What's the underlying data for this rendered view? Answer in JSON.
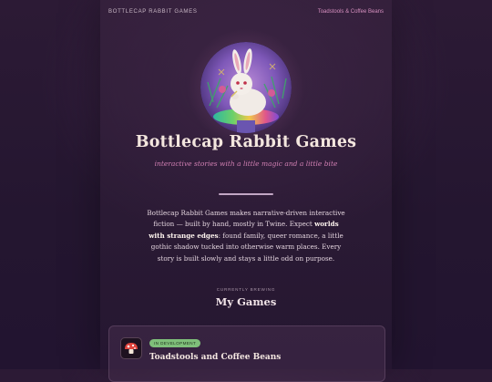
{
  "header": {
    "brand": "BOTTLECAP RABBIT GAMES",
    "nav_link": "Toadstools & Coffee Beans"
  },
  "hero": {
    "avatar_icon": "rabbit-on-mushroom-illustration",
    "title": "Bottlecap Rabbit Games",
    "tagline": "interactive stories with a little magic and a little bite"
  },
  "intro": {
    "part1": "Bottlecap Rabbit Games makes narrative-driven interactive fiction — built by hand, mostly in Twine. Expect ",
    "emphasis": "worlds with strange edges",
    "part2": ": found family, queer romance, a little gothic shadow tucked into otherwise warm places. Every story is built slowly and stays a little odd on purpose."
  },
  "games_section": {
    "kicker": "CURRENTLY BREWING",
    "title": "My Games",
    "games": [
      {
        "icon": "mushroom-icon",
        "status": "IN DEVELOPMENT",
        "title": "Toadstools and Coffee Beans"
      }
    ]
  },
  "colors": {
    "background": "#2c1a35",
    "accent_pink": "#d07fb2",
    "badge_green": "#7fbf7a",
    "title_cream": "#f3e6de"
  }
}
